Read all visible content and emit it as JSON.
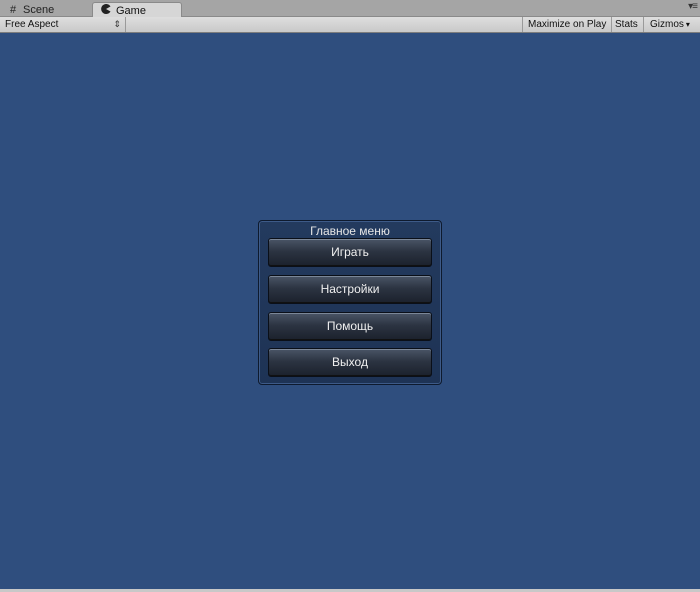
{
  "tabs": [
    {
      "label": "Scene",
      "icon": "grid-icon"
    },
    {
      "label": "Game",
      "icon": "pacman-icon"
    }
  ],
  "toolbar": {
    "aspect": "Free Aspect",
    "maximize": "Maximize on Play",
    "stats": "Stats",
    "gizmos": "Gizmos"
  },
  "menu": {
    "title": "Главное меню",
    "buttons": [
      "Играть",
      "Настройки",
      "Помощь",
      "Выход"
    ]
  },
  "colors": {
    "game_background": "#2f4e7e",
    "editor_chrome": "#a5a5a5"
  }
}
